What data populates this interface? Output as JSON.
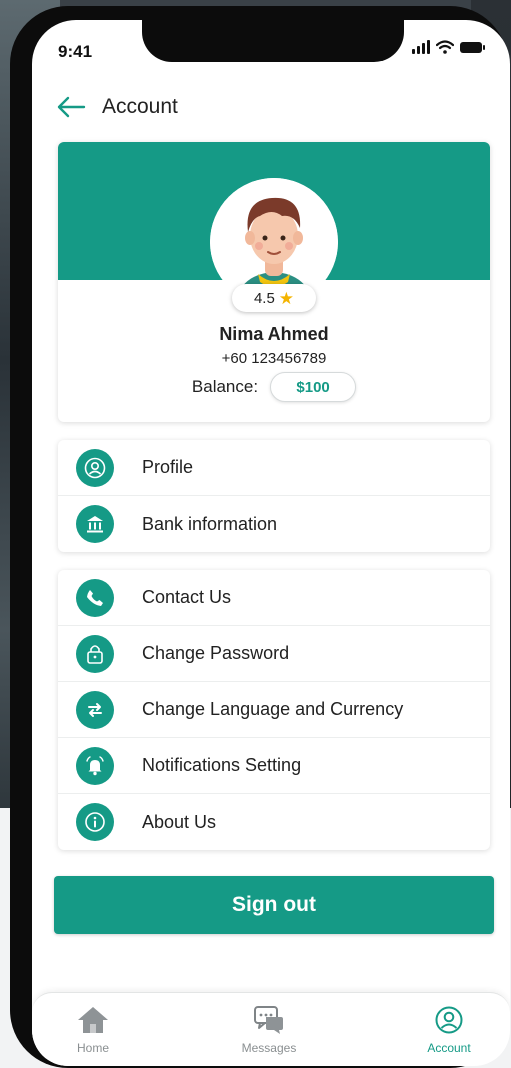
{
  "status_bar": {
    "time": "9:41"
  },
  "header": {
    "title": "Account"
  },
  "profile": {
    "rating": "4.5",
    "name": "Nima Ahmed",
    "phone": "+60 123456789",
    "balance_label": "Balance:",
    "balance_value": "$100"
  },
  "menu_group_1": [
    {
      "label": "Profile",
      "icon": "user-icon"
    },
    {
      "label": "Bank information",
      "icon": "bank-icon"
    }
  ],
  "menu_group_2": [
    {
      "label": "Contact Us",
      "icon": "phone-icon"
    },
    {
      "label": "Change Password",
      "icon": "lock-icon"
    },
    {
      "label": "Change Language and Currency",
      "icon": "swap-icon"
    },
    {
      "label": "Notifications Setting",
      "icon": "bell-icon"
    },
    {
      "label": "About Us",
      "icon": "info-icon"
    }
  ],
  "signout_label": "Sign out",
  "bottom_nav": [
    {
      "label": "Home",
      "icon": "home-icon"
    },
    {
      "label": "Messages",
      "icon": "messages-icon"
    },
    {
      "label": "Account",
      "icon": "account-icon",
      "active": true
    }
  ],
  "colors": {
    "accent": "#159a86",
    "text": "#222222",
    "star": "#f4b400"
  }
}
